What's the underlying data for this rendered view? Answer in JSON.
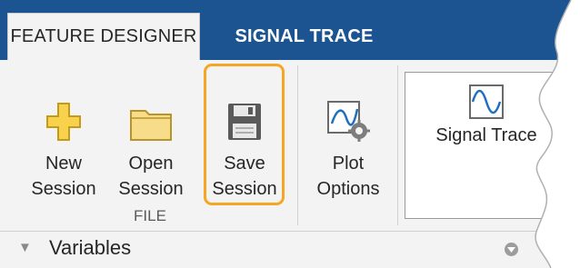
{
  "tabs": [
    {
      "label": "FEATURE DESIGNER",
      "active": true
    },
    {
      "label": "SIGNAL TRACE",
      "active": false
    }
  ],
  "toolstrip": {
    "new_session": {
      "line1": "New",
      "line2": "Session",
      "icon": "plus-icon"
    },
    "open_session": {
      "line1": "Open",
      "line2": "Session",
      "icon": "folder-icon"
    },
    "save_session": {
      "line1": "Save",
      "line2": "Session",
      "icon": "floppy-disk-icon"
    },
    "plot_options": {
      "line1": "Plot",
      "line2": "Options",
      "icon": "plot-gear-icon"
    },
    "file_group_label": "FILE",
    "gallery": {
      "item_label": "Signal Trace",
      "icon": "signal-trace-icon"
    }
  },
  "variables": {
    "label": "Variables"
  },
  "colors": {
    "tabbar": "#1c5492",
    "highlight": "#f5a623",
    "toolstrip_bg": "#f3f3f3"
  }
}
